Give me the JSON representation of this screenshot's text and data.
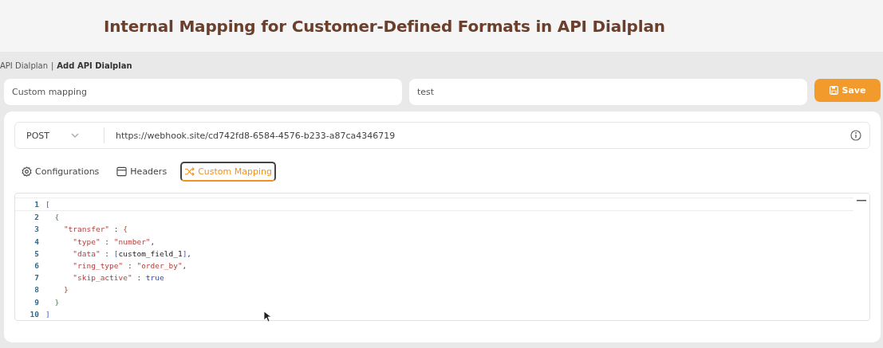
{
  "title": "Internal Mapping for Customer-Defined Formats in API Dialplan",
  "breadcrumb": {
    "parent": "API Dialplan",
    "separator": "|",
    "current": "Add API Dialplan"
  },
  "fields": [
    {
      "value": "Custom mapping"
    },
    {
      "value": "test"
    }
  ],
  "save_button": {
    "label": "Save"
  },
  "request": {
    "method": "POST",
    "url": "https://webhook.site/cd742fd8-6584-4576-b233-a87ca4346719"
  },
  "tabs": [
    {
      "label": "Configurations",
      "kind": "settings",
      "selected": false
    },
    {
      "label": "Headers",
      "kind": "headers",
      "selected": false
    },
    {
      "label": "Custom Mapping",
      "kind": "mapping",
      "selected": true
    }
  ],
  "editor": {
    "lines": [
      {
        "number": "1",
        "tokens": [
          {
            "kind": "bracket",
            "text": "["
          }
        ]
      },
      {
        "number": "2",
        "tokens": [
          {
            "kind": "brace1",
            "text": "  {"
          }
        ]
      },
      {
        "number": "3",
        "tokens": [
          {
            "kind": "string",
            "text": "    \"transfer\""
          },
          {
            "kind": "punct",
            "text": " : "
          },
          {
            "kind": "brace2",
            "text": "{"
          }
        ]
      },
      {
        "number": "4",
        "tokens": [
          {
            "kind": "string",
            "text": "      \"type\""
          },
          {
            "kind": "punct",
            "text": " : "
          },
          {
            "kind": "string",
            "text": "\"number\""
          },
          {
            "kind": "punct",
            "text": ","
          }
        ]
      },
      {
        "number": "5",
        "tokens": [
          {
            "kind": "string",
            "text": "      \"data\""
          },
          {
            "kind": "punct",
            "text": " : "
          },
          {
            "kind": "bracket",
            "text": "["
          },
          {
            "kind": "plain",
            "text": "custom_field_1"
          },
          {
            "kind": "bracket",
            "text": "]"
          },
          {
            "kind": "punct",
            "text": ","
          }
        ]
      },
      {
        "number": "6",
        "tokens": [
          {
            "kind": "string",
            "text": "      \"ring_type\""
          },
          {
            "kind": "punct",
            "text": " : "
          },
          {
            "kind": "string",
            "text": "\"order_by\""
          },
          {
            "kind": "punct",
            "text": ","
          }
        ]
      },
      {
        "number": "7",
        "tokens": [
          {
            "kind": "string",
            "text": "      \"skip_active\""
          },
          {
            "kind": "punct",
            "text": " : "
          },
          {
            "kind": "keyword",
            "text": "true"
          }
        ]
      },
      {
        "number": "8",
        "tokens": [
          {
            "kind": "brace2",
            "text": "    }"
          }
        ]
      },
      {
        "number": "9",
        "tokens": [
          {
            "kind": "brace1",
            "text": "  }"
          }
        ]
      },
      {
        "number": "10",
        "tokens": [
          {
            "kind": "bracket",
            "text": "]"
          }
        ]
      }
    ]
  }
}
